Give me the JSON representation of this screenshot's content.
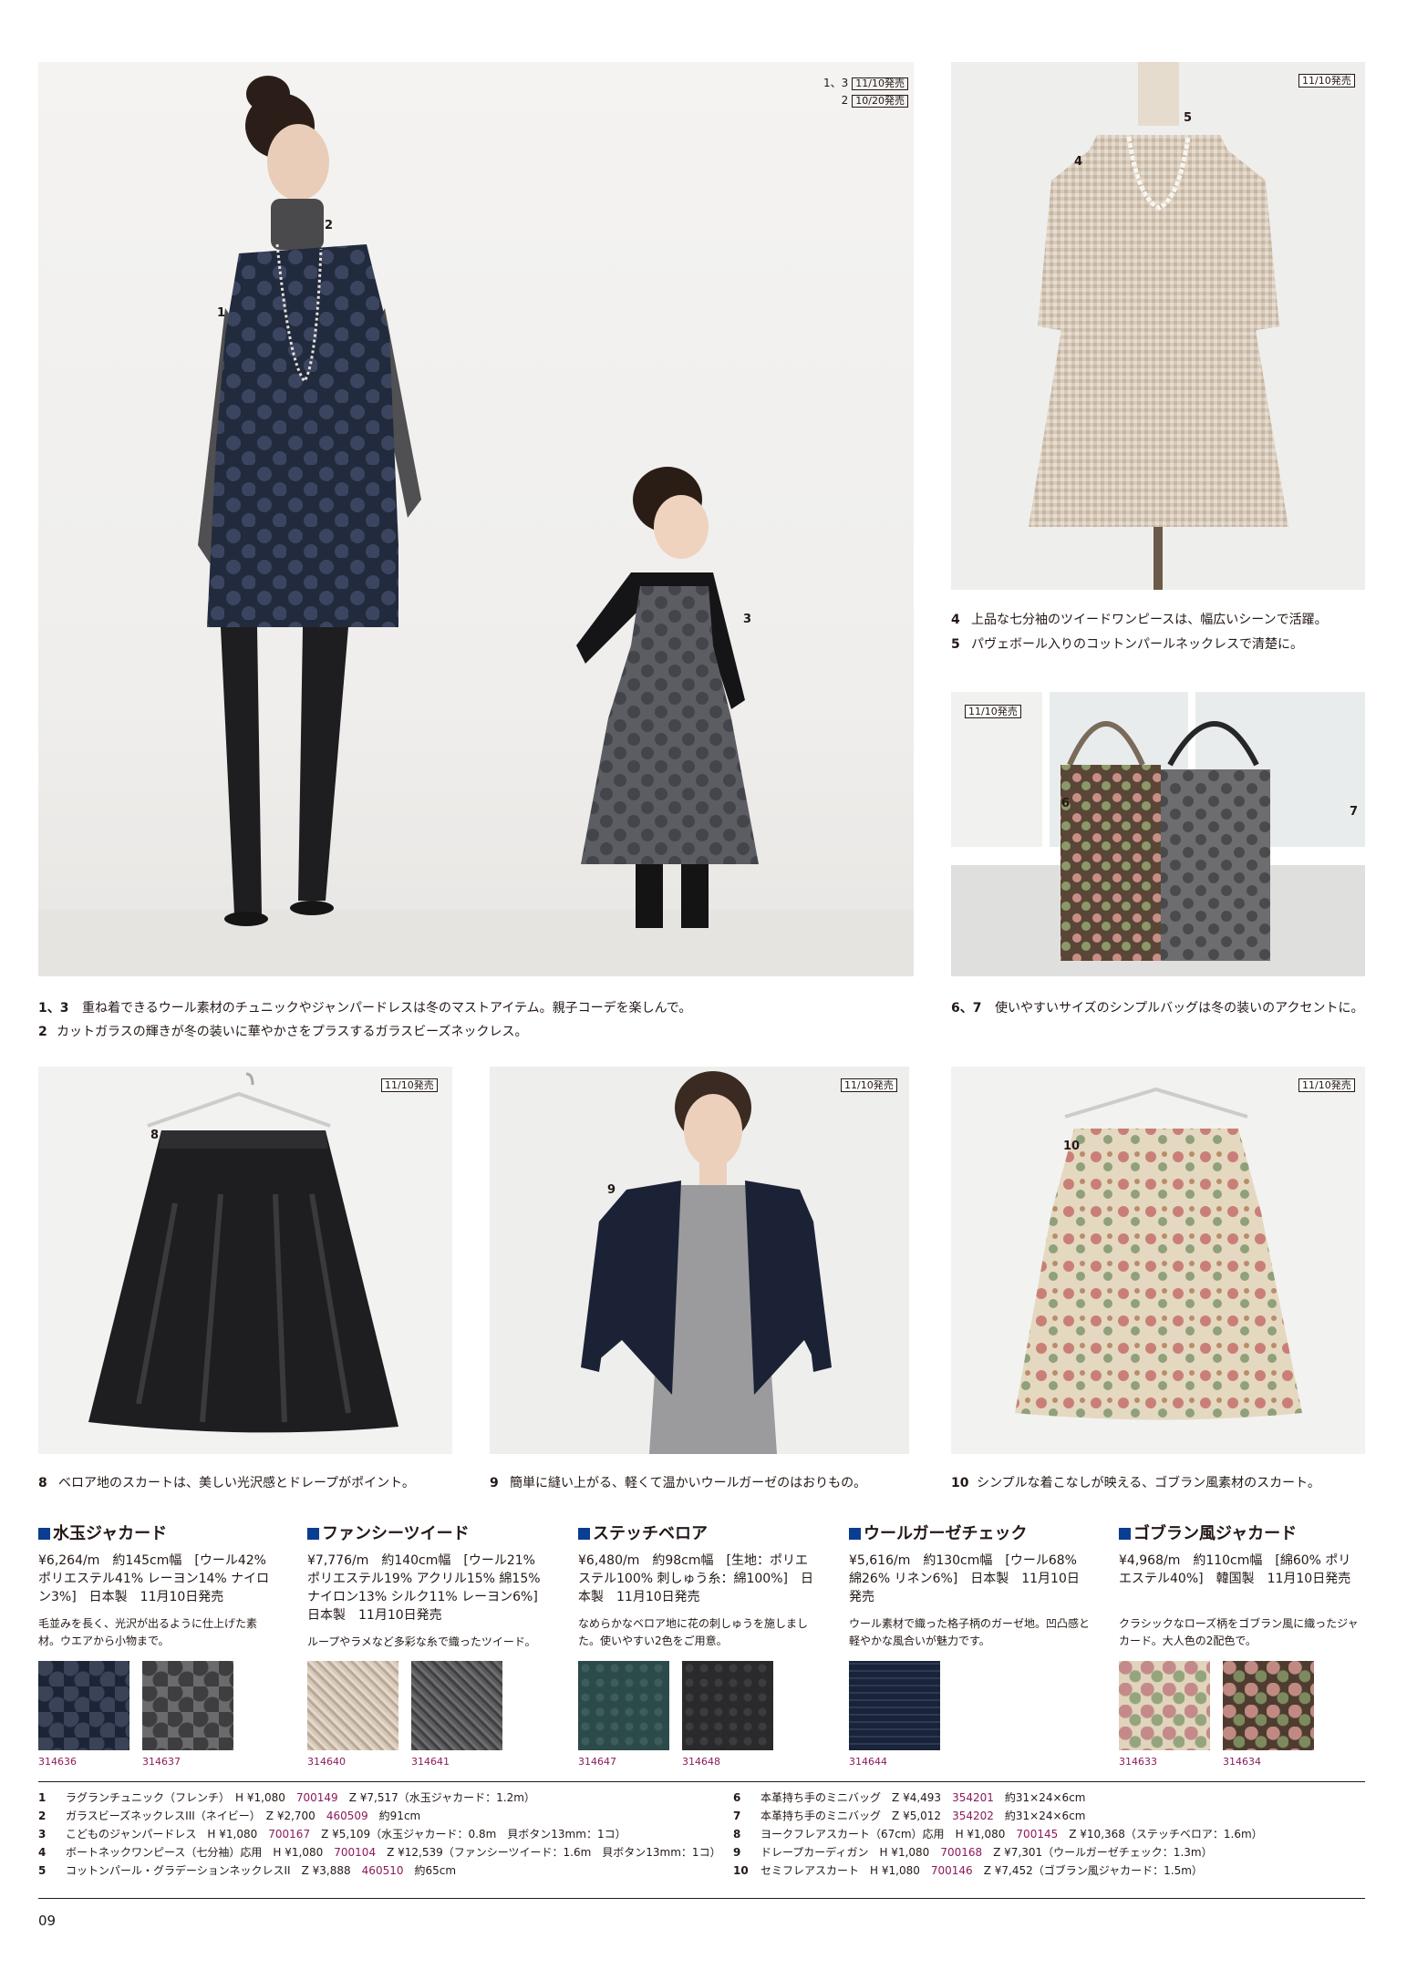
{
  "badges": {
    "main_line1_num": "1、3",
    "main_line1_badge": "11/10発売",
    "main_line2_num": "2",
    "main_line2_badge": "10/20発売",
    "dress": "11/10発売",
    "bags": "11/10発売",
    "skirt": "11/10発売",
    "cardigan": "11/10発売",
    "gobelin": "11/10発売"
  },
  "photo_numbers": {
    "n1": "1",
    "n2": "2",
    "n3": "3",
    "n4": "4",
    "n5": "5",
    "n6": "6",
    "n7": "7",
    "n8": "8",
    "n9": "9",
    "n10": "10"
  },
  "captions": {
    "c45a_num": "4",
    "c45a_text": "上品な七分袖のツイードワンピースは、幅広いシーンで活躍。",
    "c45b_num": "5",
    "c45b_text": "パヴェボール入りのコットンパールネックレスで清楚に。",
    "c13_num": "1、3",
    "c13_text": "重ね着できるウール素材のチュニックやジャンパードレスは冬のマストアイテム。親子コーデを楽しんで。",
    "c2_num": "2",
    "c2_text": "カットガラスの輝きが冬の装いに華やかさをプラスするガラスビーズネックレス。",
    "c67_num": "6、7",
    "c67_text": "使いやすいサイズのシンプルバッグは冬の装いのアクセントに。",
    "c8_num": "8",
    "c8_text": "ベロア地のスカートは、美しい光沢感とドレープがポイント。",
    "c9_num": "9",
    "c9_text": "簡単に縫い上がる、軽くて温かいウールガーゼのはおりもの。",
    "c10_num": "10",
    "c10_text": "シンプルな着こなしが映える、ゴブラン風素材のスカート。"
  },
  "fabrics": [
    {
      "title": "水玉ジャカード",
      "spec": "¥6,264/m　約145cm幅　[ウール42% ポリエステル41% レーヨン14% ナイロン3%]　日本製　11月10日発売",
      "desc": "毛並みを長く、光沢が出るように仕上げた素材。ウエアから小物まで。",
      "codes": [
        "314636",
        "314637"
      ],
      "colors": [
        "#1c2438",
        "#5a5a5c"
      ],
      "dot_colors": [
        "#3a4358",
        "#3e3e40"
      ]
    },
    {
      "title": "ファンシーツイード",
      "spec": "¥7,776/m　約140cm幅　[ウール21% ポリエステル19% アクリル15% 綿15% ナイロン13% シルク11% レーヨン6%]　日本製　11月10日発売",
      "desc": "ループやラメなど多彩な糸で織ったツイード。",
      "codes": [
        "314640",
        "314641"
      ],
      "colors": [
        "#c9b9a6",
        "#4e4e50"
      ],
      "dot_colors": [
        "#e3d8cb",
        "#6a6a6c"
      ]
    },
    {
      "title": "ステッチベロア",
      "spec": "¥6,480/m　約98cm幅　[生地：ポリエステル100% 刺しゅう糸：綿100%]　日本製　11月10日発売",
      "desc": "なめらかなベロア地に花の刺しゅうを施しました。使いやすい2色をご用意。",
      "codes": [
        "314647",
        "314648"
      ],
      "colors": [
        "#2d4a4a",
        "#2a2a2c"
      ],
      "dot_colors": [
        "#3d5c5c",
        "#3c3c3e"
      ]
    },
    {
      "title": "ウールガーゼチェック",
      "spec": "¥5,616/m　約130cm幅　[ウール68% 綿26% リネン6%]　日本製　11月10日発売",
      "desc": "ウール素材で織った格子柄のガーゼ地。凹凸感と軽やかな風合いが魅力です。",
      "codes": [
        "314644"
      ],
      "colors": [
        "#1a2338"
      ],
      "dot_colors": [
        "#2c3a58"
      ]
    },
    {
      "title": "ゴブラン風ジャカード",
      "spec": "¥4,968/m　約110cm幅　[綿60% ポリエステル40%]　韓国製　11月10日発売",
      "desc": "クラシックなローズ柄をゴブラン風に織ったジャカード。大人色の2配色で。",
      "codes": [
        "314633",
        "314634"
      ],
      "colors": [
        "#d9ccb4",
        "#5a4638"
      ],
      "dot_colors": [
        "#c48a8a",
        "#b8867a"
      ]
    }
  ],
  "table_left": [
    {
      "n": "1",
      "name": "ラグランチュニック（フレンチ）",
      "pre": "H ¥1,080",
      "code": "700149",
      "post": "Z ¥7,517（水玉ジャカード：1.2m）"
    },
    {
      "n": "2",
      "name": "ガラスビーズネックレスIII（ネイビー）",
      "pre": "Z ¥2,700",
      "code": "460509",
      "post": "約91cm"
    },
    {
      "n": "3",
      "name": "こどものジャンパードレス",
      "pre": "H ¥1,080",
      "code": "700167",
      "post": "Z ¥5,109（水玉ジャカード：0.8m　貝ボタン13mm：1コ）"
    },
    {
      "n": "4",
      "name": "ボートネックワンピース（七分袖）応用",
      "pre": "H ¥1,080",
      "code": "700104",
      "post": "Z ¥12,539（ファンシーツイード：1.6m　貝ボタン13mm：1コ）"
    },
    {
      "n": "5",
      "name": "コットンパール・グラデーションネックレスII",
      "pre": "Z ¥3,888",
      "code": "460510",
      "post": "約65cm"
    }
  ],
  "table_right": [
    {
      "n": "6",
      "name": "本革持ち手のミニバッグ",
      "pre": "Z ¥4,493",
      "code": "354201",
      "post": "約31×24×6cm"
    },
    {
      "n": "7",
      "name": "本革持ち手のミニバッグ",
      "pre": "Z ¥5,012",
      "code": "354202",
      "post": "約31×24×6cm"
    },
    {
      "n": "8",
      "name": "ヨークフレアスカート（67cm）応用",
      "pre": "H ¥1,080",
      "code": "700145",
      "post": "Z ¥10,368（ステッチベロア：1.6m）"
    },
    {
      "n": "9",
      "name": "ドレープカーディガン",
      "pre": "H ¥1,080",
      "code": "700168",
      "post": "Z ¥7,301（ウールガーゼチェック：1.3m）"
    },
    {
      "n": "10",
      "name": "セミフレアスカート",
      "pre": "H ¥1,080",
      "code": "700146",
      "post": "Z ¥7,452（ゴブラン風ジャカード：1.5m）"
    }
  ],
  "page_number": "09",
  "colors": {
    "accent_blue": "#0b3d91",
    "product_code": "#8b1a5a"
  }
}
